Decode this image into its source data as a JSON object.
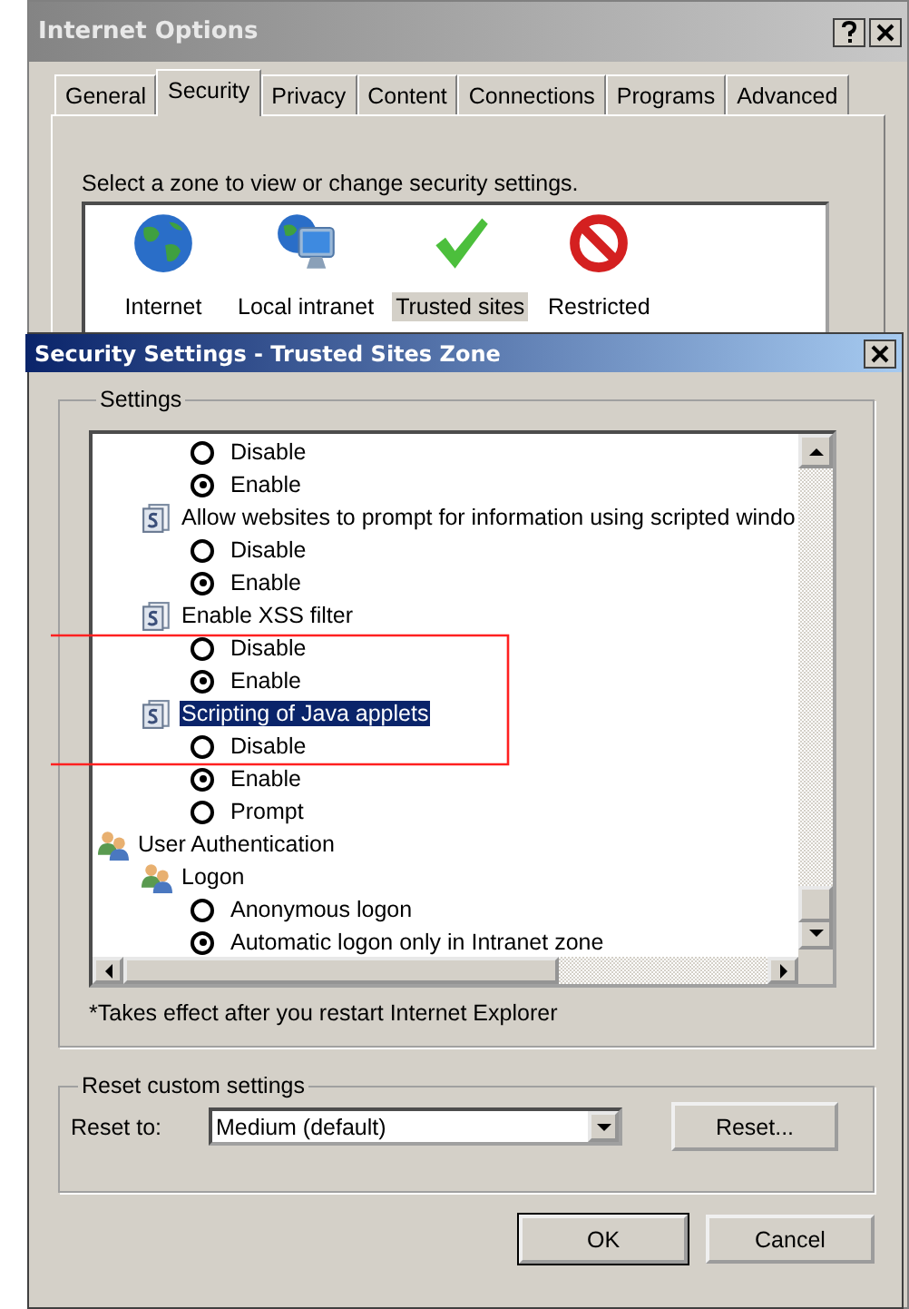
{
  "background_window": {
    "title": "Internet Options",
    "tabs": [
      {
        "label": "General",
        "selected": false
      },
      {
        "label": "Security",
        "selected": true
      },
      {
        "label": "Privacy",
        "selected": false
      },
      {
        "label": "Content",
        "selected": false
      },
      {
        "label": "Connections",
        "selected": false
      },
      {
        "label": "Programs",
        "selected": false
      },
      {
        "label": "Advanced",
        "selected": false
      }
    ],
    "zone_prompt": "Select a zone to view or change security settings.",
    "zones": [
      {
        "kind": "internet",
        "label": "Internet",
        "selected": false
      },
      {
        "kind": "intranet",
        "label": "Local intranet",
        "selected": false
      },
      {
        "kind": "trusted",
        "label": "Trusted sites",
        "selected": true
      },
      {
        "kind": "restricted",
        "label": "Restricted",
        "selected": false
      }
    ]
  },
  "dialog": {
    "title": "Security Settings - Trusted Sites Zone",
    "settings": {
      "label": "Settings",
      "rows": [
        {
          "kind": "continued",
          "children": [
            {
              "kind": "continued",
              "children": [
                {
                  "kind": "option",
                  "label": "Disable",
                  "selected": false
                },
                {
                  "kind": "option",
                  "label": "Enable",
                  "selected": true
                }
              ]
            },
            {
              "kind": "setting",
              "label": "Allow websites to prompt for information using scripted windo",
              "selected": false,
              "children": [
                {
                  "kind": "option",
                  "label": "Disable",
                  "selected": false
                },
                {
                  "kind": "option",
                  "label": "Enable",
                  "selected": true
                }
              ]
            },
            {
              "kind": "setting",
              "label": "Enable XSS filter",
              "selected": false,
              "children": [
                {
                  "kind": "option",
                  "label": "Disable",
                  "selected": false
                },
                {
                  "kind": "option",
                  "label": "Enable",
                  "selected": true
                }
              ]
            },
            {
              "kind": "setting",
              "label": "Scripting of Java applets",
              "selected": true,
              "children": [
                {
                  "kind": "option",
                  "label": "Disable",
                  "selected": false
                },
                {
                  "kind": "option",
                  "label": "Enable",
                  "selected": true
                },
                {
                  "kind": "option",
                  "label": "Prompt",
                  "selected": false
                }
              ]
            }
          ]
        },
        {
          "kind": "group",
          "label": "User Authentication",
          "selected": false,
          "children": [
            {
              "kind": "subgroup",
              "label": "Logon",
              "selected": false,
              "children": [
                {
                  "kind": "option",
                  "label": "Anonymous logon",
                  "selected": false
                },
                {
                  "kind": "option",
                  "label": "Automatic logon only in Intranet zone",
                  "selected": true
                }
              ]
            }
          ]
        }
      ]
    },
    "footnote": "*Takes effect after you restart Internet Explorer",
    "reset": {
      "label": "Reset custom settings",
      "reset_to_label": "Reset to:",
      "dropdown_value": "Medium (default)",
      "button": "Reset..."
    },
    "buttons": [
      {
        "label": "OK",
        "default": true
      },
      {
        "label": "Cancel",
        "default": false
      }
    ]
  }
}
